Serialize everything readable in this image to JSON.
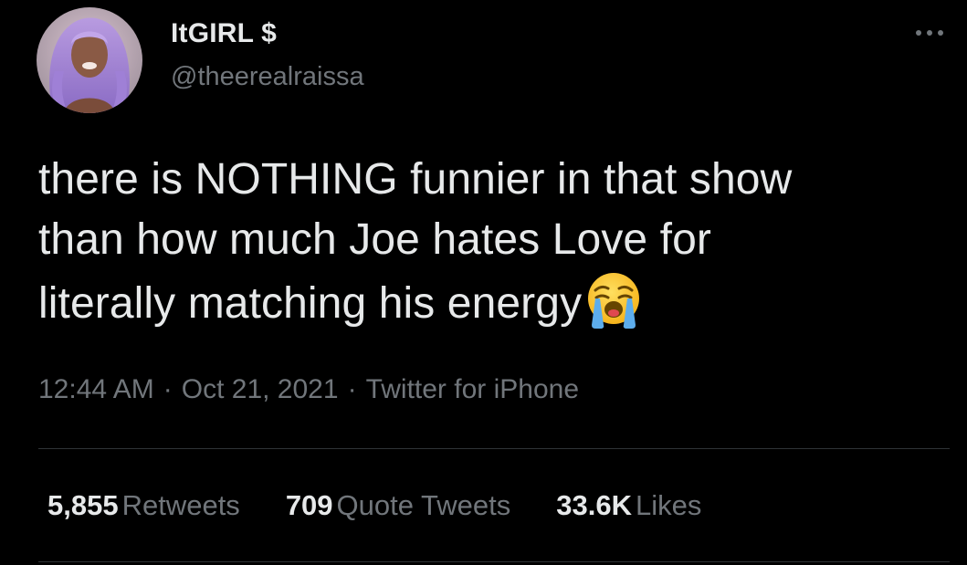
{
  "user": {
    "display_name": "ItGIRL $",
    "handle": "@theerealraissa",
    "avatar": "profile-photo"
  },
  "menu_icon": "more-horizontal-icon",
  "tweet": {
    "lines": [
      "there is NOTHING funnier in that show",
      "than how much Joe hates Love for",
      "literally matching his energy"
    ],
    "emoji": "loudly-crying-face-icon"
  },
  "meta": {
    "time": "12:44 AM",
    "separator": "·",
    "date": "Oct 21, 2021",
    "source": "Twitter for iPhone"
  },
  "stats": {
    "retweets": {
      "count": "5,855",
      "label": "Retweets"
    },
    "quotes": {
      "count": "709",
      "label": "Quote Tweets"
    },
    "likes": {
      "count": "33.6K",
      "label": "Likes"
    }
  },
  "colors": {
    "background": "#000000",
    "text_primary": "#e7e9ea",
    "text_secondary": "#71767b",
    "divider": "#2f3336"
  }
}
